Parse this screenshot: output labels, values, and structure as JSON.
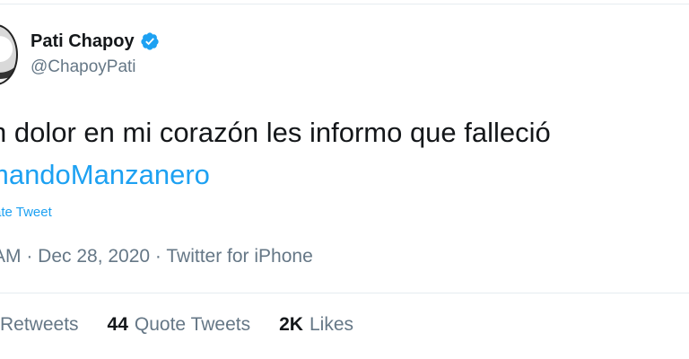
{
  "author": {
    "display_name": "Pati Chapoy",
    "handle": "@ChapoyPati",
    "verified": true
  },
  "tweet": {
    "text": "n dolor en mi corazón les informo que falleció",
    "hashtag": "mandoManzanero",
    "translate_label": "ate Tweet",
    "meta": "AM · Dec 28, 2020 · Twitter for iPhone"
  },
  "stats": {
    "retweets_label": "Retweets",
    "quote_count": "44",
    "quote_label": "Quote Tweets",
    "likes_count": "2K",
    "likes_label": "Likes"
  },
  "icons": {
    "verified": "verified-badge-icon"
  },
  "colors": {
    "link": "#1da1f2",
    "secondary_text": "#657786",
    "primary_text": "#14171a",
    "divider": "#e6ecf0"
  }
}
